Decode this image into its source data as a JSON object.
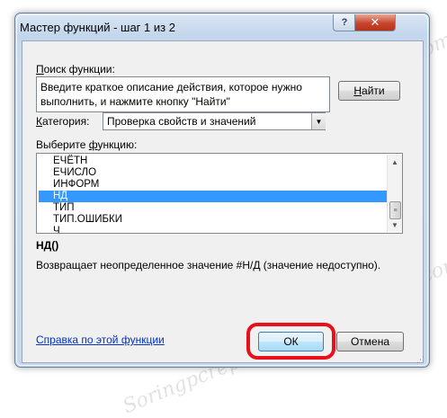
{
  "window": {
    "title": "Мастер функций - шаг 1 из 2",
    "help_symbol": "?",
    "close_symbol": "✕"
  },
  "search": {
    "label_prefix": "",
    "label_underlined": "П",
    "label_rest": "оиск функции:",
    "text": "Введите краткое описание действия, которое нужно выполнить, и нажмите кнопку \"Найти\"",
    "find_button_underlined": "Н",
    "find_button_rest": "айти"
  },
  "category": {
    "label_underlined": "К",
    "label_rest": "атегория:",
    "selected": "Проверка свойств и значений"
  },
  "function_list": {
    "label_prefix": "Выберите ",
    "label_underlined": "ф",
    "label_rest": "ункцию:",
    "items": [
      "ЕЧЁТН",
      "ЕЧИСЛО",
      "ИНФОРМ",
      "НД",
      "ТИП",
      "ТИП.ОШИБКИ",
      "Ч"
    ],
    "selected_index": 3
  },
  "selected_function": {
    "signature": "НД()",
    "description": "Возвращает неопределенное значение #Н/Д (значение недоступно)."
  },
  "footer": {
    "help_link": "Справка по этой функции",
    "ok_label": "ОК",
    "cancel_label": "Отмена"
  },
  "colors": {
    "highlight": "#e8101a",
    "selection": "#3399ff",
    "link": "#0033cc"
  },
  "watermark": "Soringpcrepair.com"
}
